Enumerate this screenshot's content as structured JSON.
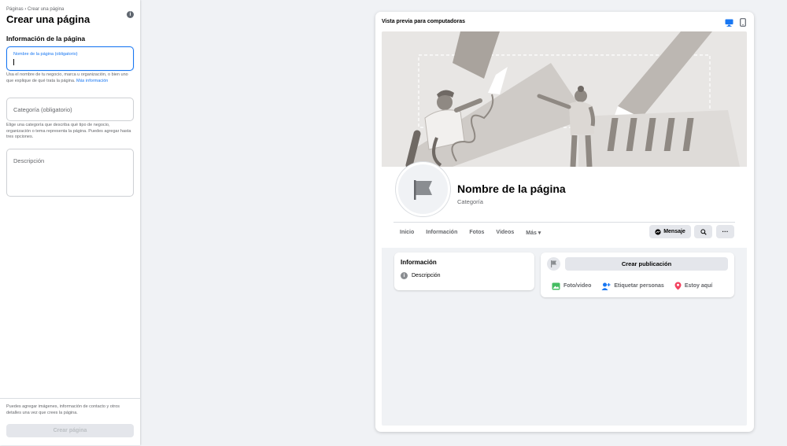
{
  "sidebar": {
    "breadcrumb": "Páginas › Crear una página",
    "title": "Crear una página",
    "section_title": "Información de la página",
    "name_field": {
      "label": "Nombre de la página (obligatorio)",
      "value": ""
    },
    "name_help": "Usa el nombre de tu negocio, marca u organización, o bien uno que explique de qué trata la página.",
    "name_help_link": "Más información",
    "category_field": {
      "placeholder": "Categoría (obligatorio)"
    },
    "category_help": "Elige una categoría que describa qué tipo de negocio, organización o tema representa la página. Puedes agregar hasta tres opciones.",
    "description_field": {
      "placeholder": "Descripción"
    },
    "footer_text": "Puedes agregar imágenes, información de contacto y otros detalles una vez que crees la página.",
    "create_button": "Crear página"
  },
  "preview": {
    "title": "Vista previa para computadoras",
    "page_name": "Nombre de la página",
    "category": "Categoría",
    "tabs": [
      "Inicio",
      "Información",
      "Fotos",
      "Videos",
      "Más ▾"
    ],
    "message_button": "Mensaje",
    "info_card": {
      "title": "Información",
      "description": "Descripción"
    },
    "post_card": {
      "create_post": "Crear publicación",
      "actions": [
        "Foto/video",
        "Etiquetar personas",
        "Estoy aquí"
      ]
    }
  },
  "colors": {
    "accent": "#1877f2",
    "page_bg": "#f0f2f5",
    "photo_icon": "#45bd62",
    "location_icon": "#f3425f"
  },
  "icons": [
    "info-icon",
    "desktop-icon",
    "mobile-icon",
    "flag-icon",
    "messenger-icon",
    "search-icon",
    "more-icon",
    "photo-icon",
    "tag-people-icon",
    "location-icon"
  ]
}
